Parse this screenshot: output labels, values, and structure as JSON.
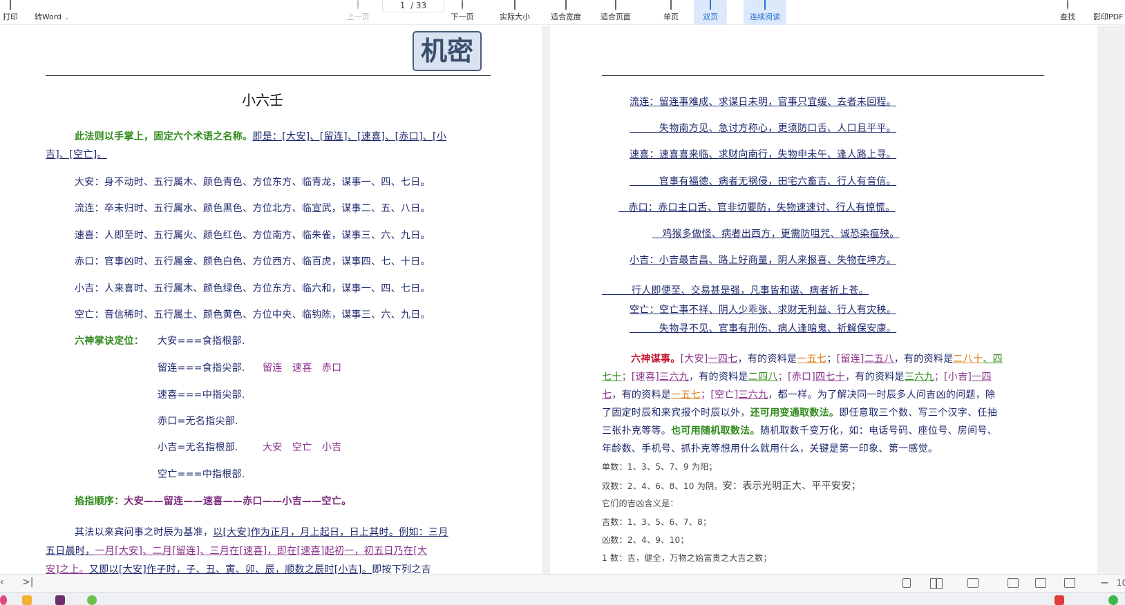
{
  "toolbar": {
    "print": "打印",
    "to_word": "转Word",
    "dropdown": "⌄",
    "prev_page": "上一页",
    "page_current": "1",
    "page_total": "/ 33",
    "next_page": "下一页",
    "actual_size": "实际大小",
    "fit_width": "适合宽度",
    "fit_page": "适合页面",
    "single_page": "单页",
    "double_page": "双页",
    "continuous": "连续阅读",
    "find": "查找",
    "shadow_pdf": "影印PDF"
  },
  "left_page": {
    "stamp": "机密",
    "title": "小六壬",
    "intro_a": "此法则以手掌上，固定六个术语之名称。",
    "intro_b": "即是：[大安]、[留连]、[速喜]、[赤口]、[小",
    "intro_c": "吉]、[空亡]。",
    "lines": [
      "大安：身不动时、五行属木、颜色青色、方位东方、临青龙，谋事一、四、七日。",
      "流连：卒未归时、五行属水、颜色黑色、方位北方、临宣武，谋事二、五、八日。",
      "速喜：人即至时、五行属火、颜色红色、方位南方、临朱雀，谋事三、六、九日。",
      "赤口：官事凶时、五行属金、颜色白色、方位西方、临百虎，谋事四、七、十日。",
      "小吉：人来喜时、五行属木、颜色绿色、方位东方、临六和，谋事一、四、七日。",
      "空亡：音信稀时、五行属土、颜色黄色、方位中央、临钩陈，谋事三、六、九日。"
    ],
    "palm_label": "六神掌诀定位：",
    "palm": [
      "大安===食指根部.",
      "留连===食指尖部.",
      "速喜===中指尖部.",
      "赤口=无名指尖部.",
      "小吉=无名指根部.",
      "空亡===中指根部."
    ],
    "palm_note_1": "留连　速喜　赤口",
    "palm_note_2": "大安　空亡　小吉",
    "order_label": "掐指顺序：",
    "order": "大安——留连——速喜——赤口——小吉——空亡。",
    "p1_a": "其法以来宾问事之时辰为基准，",
    "p1_b": "以[大安]作为正月，月上起日，日上其时。例如：三月",
    "p2_a": "五日晨时，",
    "p2_b": "一月[大安]、二月[留连]、三月在[速喜]，即在[速喜]起初一，初五日乃在[大",
    "p3_a": "安]之上。",
    "p3_b": "又即以[大安]作子时，子、丑、寅、卯、辰，顺数之辰时[小吉]。",
    "p3_c": "即按下列之吉"
  },
  "right_page": {
    "r1": "流连：留连事难成、求谋日未明，官事只宜缓、去者未回程。",
    "r2": "失物南方见、急讨方称心，更须防口舌、人口且平平。",
    "r3": "速喜：速喜喜来临、求财向南行，失物申未午、逢人路上寻。",
    "r4": "官事有福德、病者无祸侵，田宅六畜吉、行人有音信。",
    "r5": "赤口：赤口主口舌、官非切要防，失物速速讨、行人有惊慌。",
    "r6": "鸡猴多做怪、病者出西方，更需防咀咒、诚恐染瘟殃。",
    "r7": "小吉：小吉最吉昌、路上好商量，阴人来报喜、失物在坤方。",
    "r8": "行人即便至、交易甚是强，凡事皆和谐、病者祈上苍。",
    "r9": "空亡：空亡事不祥、阴人少乖张、求财无利益、行人有灾秧。",
    "r10": "失物寻不见、官事有刑伤、病人逢暗鬼、祈解保安康。",
    "m_label": "六神谋事。",
    "m1_a": "[大安]",
    "m1_b": "一四七",
    "m1_c": "，有的资料是",
    "m1_d": "一五七",
    "m1_e": "；",
    "m1_f": "[留连]",
    "m1_g": "二五八",
    "m1_h": "，有的资料是",
    "m1_i": "二八十",
    "m1_j": "、四",
    "m2_a": "七十",
    "m2_b": "；[速喜]",
    "m2_c": "三六九",
    "m2_d": "，有的资料是",
    "m2_e": "二四八",
    "m2_f": "；[赤口]",
    "m2_g": "四七十",
    "m2_h": "，有的资料是",
    "m2_i": "三六九",
    "m2_j": "；[小吉]",
    "m2_k": "一四",
    "m3_a": "七",
    "m3_b": "，有的资料是",
    "m3_c": "一五七",
    "m3_d": "；[空亡]",
    "m3_e": "三六九",
    "m3_f": "，都一样。为了解决同一时辰多人问吉凶的问题，除",
    "m4_a": "了固定时辰和来宾报个时辰以外，",
    "m4_b": "还可用变通取数法。",
    "m4_c": "即任意取三个数、写三个汉字、任抽",
    "m5_a": "三张扑克等等。",
    "m5_b": "也可用随机取数法。",
    "m5_c": "随机取数千变万化，如：电话号码、座位号、房间号、",
    "m6": "年龄数、手机号、抓扑克等想用什么就用什么，关键是第一印象、第一感觉。",
    "s1": "单数：1、3、5、7、9 为阳；",
    "s2_a": "双数：2、4、6、8、10 为阴。",
    "s2_b": "安：表示光明正大、平平安安；",
    "s3": "它们的吉凶含义是：",
    "s4": "吉数：1、3、5、6、7、8；",
    "s5": "凶数：2、4、9、10；",
    "s6": "1 数：吉，健全，万物之始富贵之大吉之数；"
  },
  "statusbar": {
    "last_page": ">|",
    "edge": "‹",
    "zoom_minus": "−",
    "zoom": "10"
  }
}
